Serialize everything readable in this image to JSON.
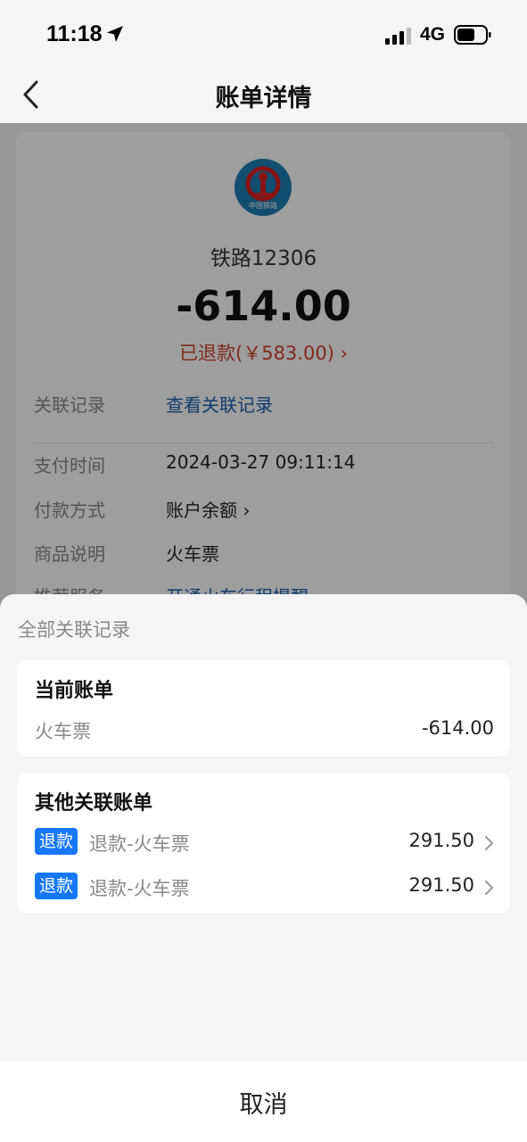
{
  "status_bar": {
    "time": "11:18",
    "network": "4G"
  },
  "nav": {
    "title": "账单详情"
  },
  "detail": {
    "merchant_name": "铁路12306",
    "logo_text": "中国铁路",
    "amount": "-614.00",
    "refund_text": "已退款(￥583.00) ›",
    "rows": [
      {
        "key": "关联记录",
        "value": "查看关联记录"
      },
      {
        "key": "支付时间",
        "value": "2024-03-27 09:11:14"
      },
      {
        "key": "付款方式",
        "value": "账户余额 ›"
      },
      {
        "key": "商品说明",
        "value": "火车票"
      },
      {
        "key": "推荐服务",
        "value": "开通火车行程提醒 ›"
      }
    ]
  },
  "sheet": {
    "title": "全部关联记录",
    "current": {
      "heading": "当前账单",
      "desc": "火车票",
      "amount": "-614.00"
    },
    "other": {
      "heading": "其他关联账单",
      "items": [
        {
          "tag": "退款",
          "desc": "退款-火车票",
          "amount": "291.50"
        },
        {
          "tag": "退款",
          "desc": "退款-火车票",
          "amount": "291.50"
        }
      ]
    },
    "cancel_label": "取消"
  },
  "colors": {
    "refund": "#d2452a",
    "tag": "#1677ff",
    "link": "#1a5fb4"
  }
}
